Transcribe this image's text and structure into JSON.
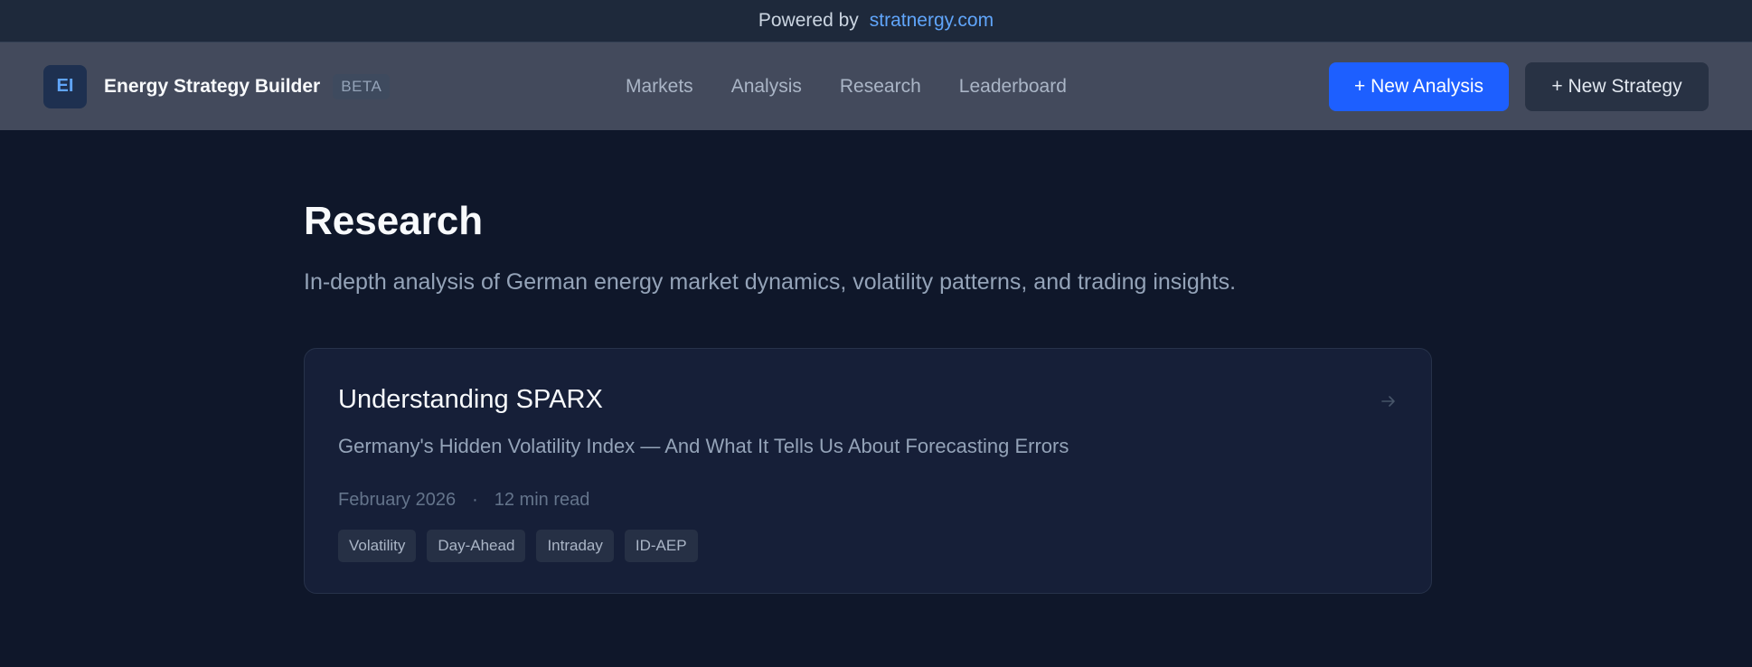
{
  "topbar": {
    "prefix": "Powered by",
    "link_text": "stratnergy.com"
  },
  "header": {
    "logo_text": "EI",
    "title": "Energy Strategy Builder",
    "badge": "BETA",
    "nav": [
      "Markets",
      "Analysis",
      "Research",
      "Leaderboard"
    ],
    "primary_button": "+ New Analysis",
    "secondary_button": "+ New Strategy"
  },
  "page": {
    "title": "Research",
    "subtitle": "In-depth analysis of German energy market dynamics, volatility patterns, and trading insights."
  },
  "articles": [
    {
      "title": "Understanding SPARX",
      "subtitle": "Germany's Hidden Volatility Index — And What It Tells Us About Forecasting Errors",
      "date": "February 2026",
      "separator": "·",
      "read_time": "12 min read",
      "tags": [
        "Volatility",
        "Day-Ahead",
        "Intraday",
        "ID-AEP"
      ],
      "icon": "arrow-right-icon"
    }
  ],
  "colors": {
    "background": "#0f172a",
    "accent": "#1d5fff",
    "link": "#60a5fa",
    "header": "#434a5c"
  }
}
